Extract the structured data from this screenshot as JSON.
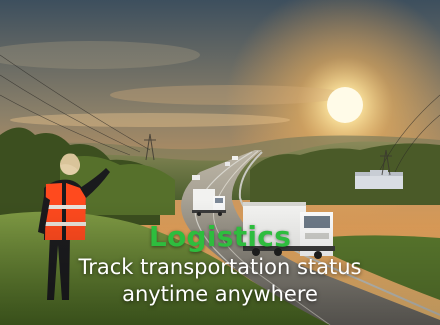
{
  "promo": {
    "title": "Logistics",
    "line1": "Track transportation status",
    "line2": "anytime anywhere"
  },
  "colors": {
    "title": "#2ebd3e",
    "subtitle": "#ffffff",
    "sky_top": "#3d4f5e",
    "sky_glow": "#f3a64e",
    "sun": "#fff6d6",
    "grass": "#6e8f3a",
    "vest": "#ff4a1e"
  },
  "icons": {
    "scene": "logistics-highway-photo"
  }
}
